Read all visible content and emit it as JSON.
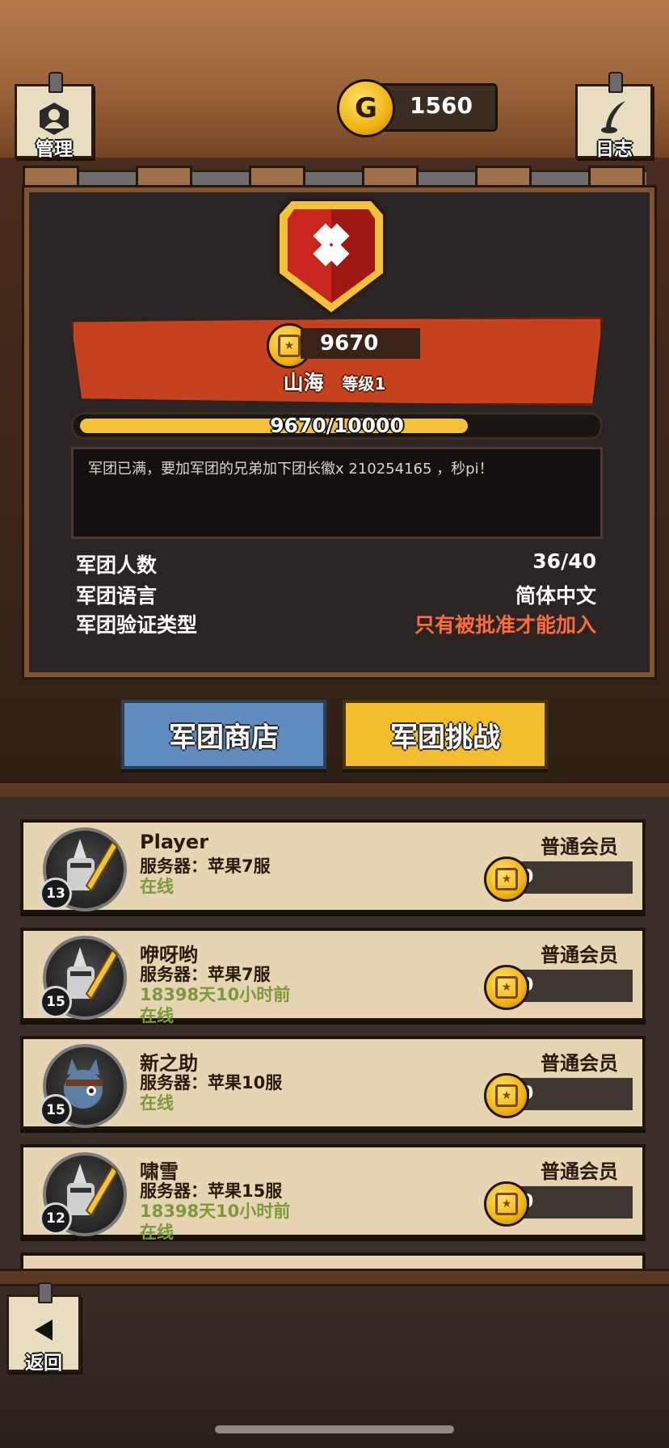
{
  "top": {
    "manage_label": "管理",
    "log_label": "日志",
    "gold_value": "1560",
    "gold_symbol": "G"
  },
  "guild": {
    "banner_score": "9670",
    "name": "山海",
    "level": "等级1",
    "progress_text": "9670/10000",
    "progress_fraction": 0.967,
    "notice": "军团已满，要加军团的兄弟加下团长徽x 210254165 ，秒pi！",
    "info": [
      {
        "key": "军团人数",
        "value": "36/40"
      },
      {
        "key": "军团语言",
        "value": "简体中文"
      },
      {
        "key": "军团验证类型",
        "value": "只有被批准才能加入"
      }
    ]
  },
  "buttons": {
    "shop": "军团商店",
    "challenge": "军团挑战"
  },
  "members": [
    {
      "name": "Player",
      "server": "服务器：苹果7服",
      "status": "在线",
      "role": "普通会员",
      "points": "0",
      "level": "13",
      "avatar": "knight-sword-icon"
    },
    {
      "name": "咿呀哟",
      "server": "服务器：苹果7服",
      "status": "18398天10小时前在线",
      "role": "普通会员",
      "points": "0",
      "level": "15",
      "avatar": "knight-sword-icon"
    },
    {
      "name": "新之助",
      "server": "服务器：苹果10服",
      "status": "在线",
      "role": "普通会员",
      "points": "0",
      "level": "15",
      "avatar": "cat-pirate-icon"
    },
    {
      "name": "啸雪",
      "server": "服务器：苹果15服",
      "status": "18398天10小时前在线",
      "role": "普通会员",
      "points": "0",
      "level": "12",
      "avatar": "knight-sword-icon"
    }
  ],
  "bottom": {
    "back_label": "返回"
  },
  "colors": {
    "accent_red": "#c6421f",
    "gold": "#f3c13a",
    "online_green": "#7c9a3a",
    "verify_red": "#ff6a3a"
  }
}
